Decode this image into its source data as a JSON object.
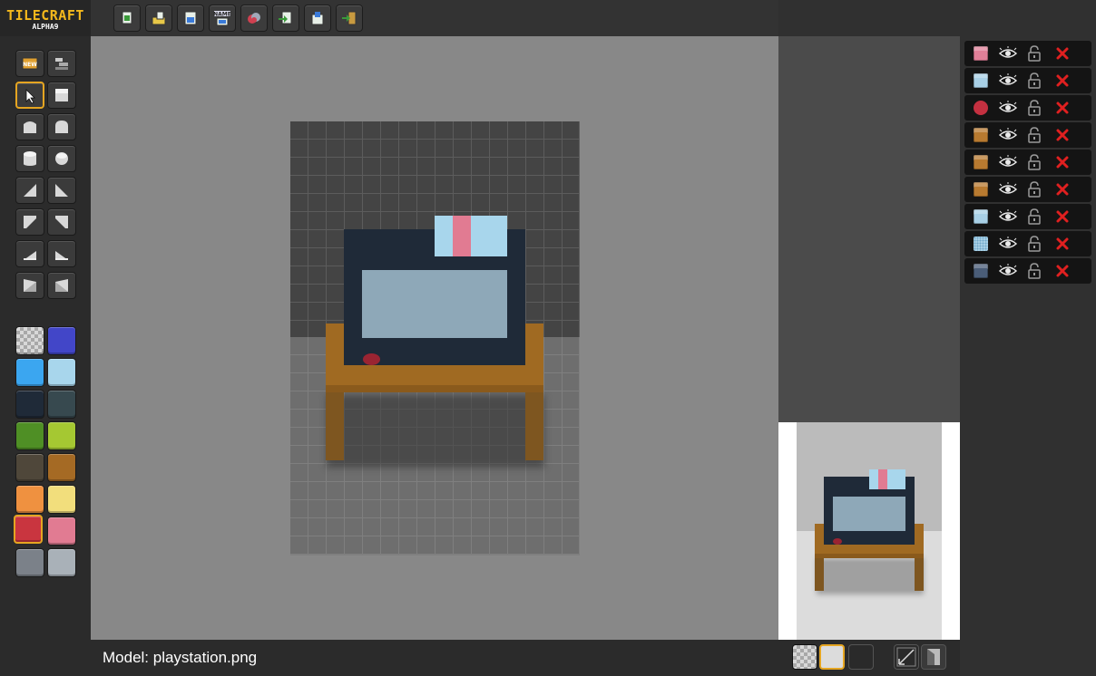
{
  "app": {
    "logo_title": "TILECRAFT",
    "logo_subtitle": "ALPHA9"
  },
  "toolbar": {
    "buttons": [
      {
        "name": "new-file-icon"
      },
      {
        "name": "open-folder-icon"
      },
      {
        "name": "save-icon"
      },
      {
        "name": "rename-icon",
        "label": "NAME"
      },
      {
        "name": "palette-icon"
      },
      {
        "name": "import-icon"
      },
      {
        "name": "export-icon"
      },
      {
        "name": "exit-icon"
      }
    ]
  },
  "tools": {
    "new_label": "NEW",
    "items": [
      "new-model-icon",
      "layers-order-icon",
      "select-icon",
      "block-icon",
      "rounded-top-icon",
      "rounded-side-icon",
      "cylinder-icon",
      "sphere-icon",
      "slope-left-icon",
      "slope-right-icon",
      "slope-top-left-icon",
      "slope-top-right-icon",
      "ramp-left-icon",
      "ramp-right-icon",
      "wedge-left-icon",
      "wedge-right-icon"
    ],
    "selected": "select-icon"
  },
  "palette": {
    "colors": [
      "transparent",
      "#4246c8",
      "#3ba6f0",
      "#a8d6ec",
      "#1f2a38",
      "#37494f",
      "#4f8f25",
      "#a5c832",
      "#4f473a",
      "#a56a24",
      "#ef9140",
      "#f2de7c",
      "#c9353f",
      "#e17b92",
      "#7b8189",
      "#a9b1b8"
    ],
    "selected_index": 12
  },
  "layers": [
    {
      "icon": "box-icon",
      "color": "#e07f98"
    },
    {
      "icon": "box-icon",
      "color": "#a8d0e6"
    },
    {
      "icon": "sphere-icon",
      "color": "#c43040"
    },
    {
      "icon": "box-icon",
      "color": "#b87a30"
    },
    {
      "icon": "box-icon",
      "color": "#b87a30"
    },
    {
      "icon": "box-icon",
      "color": "#b87a30"
    },
    {
      "icon": "box-icon",
      "color": "#a8d0e6"
    },
    {
      "icon": "box-dotted-icon",
      "color": "#a8d0e6"
    },
    {
      "icon": "box-icon",
      "color": "#4a5d78"
    }
  ],
  "status": {
    "model_label": "Model: playstation.png"
  },
  "preview_bg": {
    "options": [
      "checker",
      "light",
      "dark"
    ],
    "selected": "light"
  }
}
